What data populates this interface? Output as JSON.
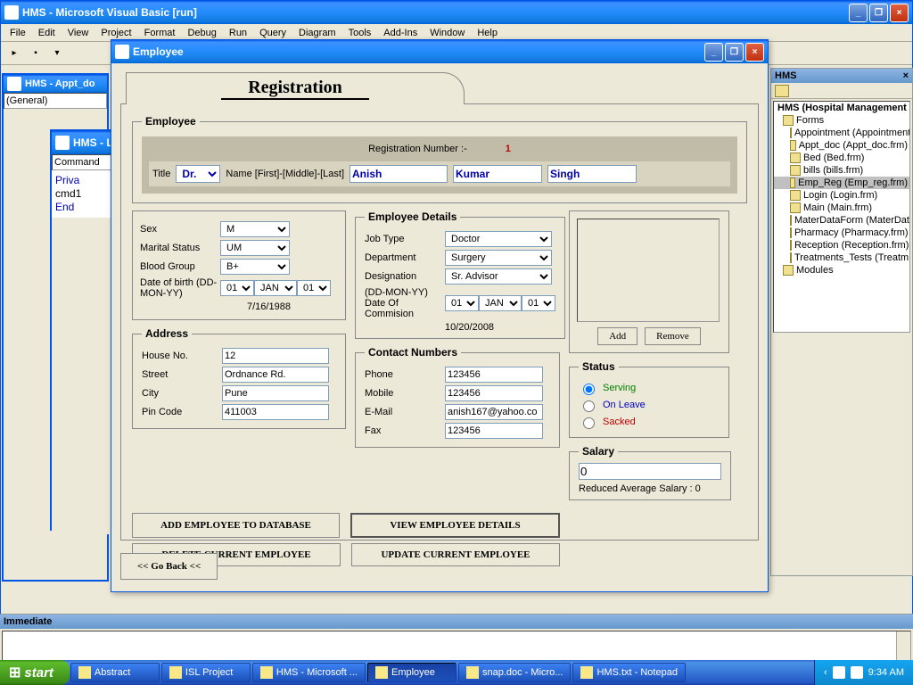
{
  "ide": {
    "title": "HMS  - Microsoft Visual Basic [run]",
    "menus": [
      "File",
      "Edit",
      "View",
      "Project",
      "Format",
      "Debug",
      "Run",
      "Query",
      "Diagram",
      "Tools",
      "Add-Ins",
      "Window",
      "Help"
    ]
  },
  "code_window1": {
    "title": "HMS - Appt_do",
    "dropdown": "(General)"
  },
  "code_window2": {
    "title": "HMS - L",
    "dropdown": "Command",
    "code_lines": [
      "Priva",
      "cmd1",
      "End "
    ]
  },
  "project": {
    "panel_title": "HMS",
    "root": "HMS (Hospital Management S",
    "folder": "Forms",
    "items": [
      "Appointment (Appointment",
      "Appt_doc (Appt_doc.frm)",
      "Bed (Bed.frm)",
      "bills (bills.frm)",
      "Emp_Reg (Emp_reg.frm)",
      "Login (Login.frm)",
      "Main (Main.frm)",
      "MaterDataForm (MaterData",
      "Pharmacy (Pharmacy.frm)",
      "Reception (Reception.frm)",
      "Treatments_Tests (Treatm"
    ],
    "folder2": "Modules"
  },
  "immediate": {
    "title": "Immediate"
  },
  "dialog": {
    "title": "Employee",
    "tab_label": "Registration",
    "fieldset_employee": "Employee",
    "reg_num_label": "Registration Number :-",
    "reg_num_value": "1",
    "title_label": "Title",
    "title_value": "Dr.",
    "name_label": "Name [First]-[Middle]-[Last]",
    "name_first": "Anish",
    "name_middle": "Kumar",
    "name_last": "Singh",
    "sex_label": "Sex",
    "sex_value": "M",
    "marital_label": "Marital Status",
    "marital_value": "UM",
    "blood_label": "Blood Group",
    "blood_value": "B+",
    "dob_label": "Date of birth (DD-MON-YY)",
    "dob_dd": "01",
    "dob_mon": "JAN",
    "dob_yy": "01",
    "dob_display": "7/16/1988",
    "details_legend": "Employee Details",
    "job_label": "Job Type",
    "job_value": "Doctor",
    "dept_label": "Department",
    "dept_value": "Surgery",
    "desig_label": "Designation",
    "desig_value": "Sr. Advisor",
    "doc_label": "(DD-MON-YY) Date Of Commision",
    "doc_dd": "01",
    "doc_mon": "JAN",
    "doc_yy": "01",
    "doc_display": "10/20/2008",
    "address_legend": "Address",
    "house_label": "House No.",
    "house_value": "12",
    "street_label": "Street",
    "street_value": "Ordnance Rd.",
    "city_label": "City",
    "city_value": "Pune",
    "pin_label": "Pin Code",
    "pin_value": "411003",
    "contact_legend": "Contact Numbers",
    "phone_label": "Phone",
    "phone_value": "123456",
    "mobile_label": "Mobile",
    "mobile_value": "123456",
    "email_label": "E-Mail",
    "email_value": "anish167@yahoo.co",
    "fax_label": "Fax",
    "fax_value": "123456",
    "btn_add_db": "ADD EMPLOYEE TO DATABASE",
    "btn_view": "VIEW EMPLOYEE DETAILS",
    "btn_delete": "DELETE CURRENT EMPLOYEE",
    "btn_update": "UPDATE CURRENT EMPLOYEE",
    "img_add": "Add",
    "img_remove": "Remove",
    "status_legend": "Status",
    "status_serving": "Serving",
    "status_onleave": "On Leave",
    "status_sacked": "Sacked",
    "salary_legend": "Salary",
    "salary_value": "0",
    "salary_note": "Reduced Average Salary : 0",
    "goback": "<< Go Back <<"
  },
  "taskbar": {
    "start": "start",
    "items": [
      {
        "label": "Abstract"
      },
      {
        "label": "ISL Project"
      },
      {
        "label": "HMS - Microsoft ..."
      },
      {
        "label": "Employee",
        "active": true
      },
      {
        "label": "snap.doc - Micro..."
      },
      {
        "label": "HMS.txt - Notepad"
      }
    ],
    "time": "9:34 AM"
  }
}
